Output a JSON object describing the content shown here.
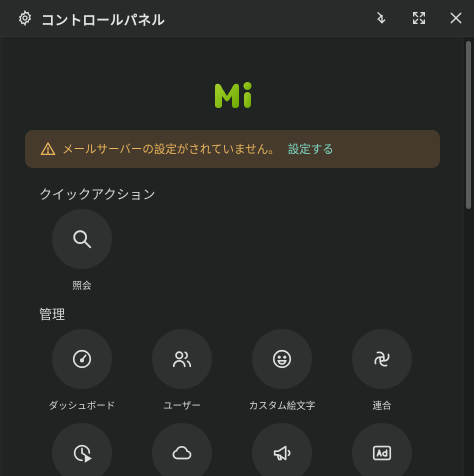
{
  "window": {
    "title": "コントロールパネル"
  },
  "warning": {
    "message": "メールサーバーの設定がされていません。",
    "link": "設定する"
  },
  "quick_actions": {
    "title": "クイックアクション",
    "items": [
      {
        "label": "照会",
        "icon": "search-icon"
      }
    ]
  },
  "admin": {
    "title": "管理",
    "items": [
      {
        "label": "ダッシュボード",
        "icon": "gauge-icon"
      },
      {
        "label": "ユーザー",
        "icon": "users-icon"
      },
      {
        "label": "カスタム絵文字",
        "icon": "emoji-icon"
      },
      {
        "label": "連合",
        "icon": "whirl-icon"
      },
      {
        "label": "",
        "icon": "clock-play-icon"
      },
      {
        "label": "",
        "icon": "cloud-icon"
      },
      {
        "label": "",
        "icon": "megaphone-icon"
      },
      {
        "label": "",
        "icon": "ad-icon"
      }
    ]
  },
  "colors": {
    "accent": "#86b300",
    "warning_text": "#e9b45c",
    "link": "#7fd9c6"
  }
}
